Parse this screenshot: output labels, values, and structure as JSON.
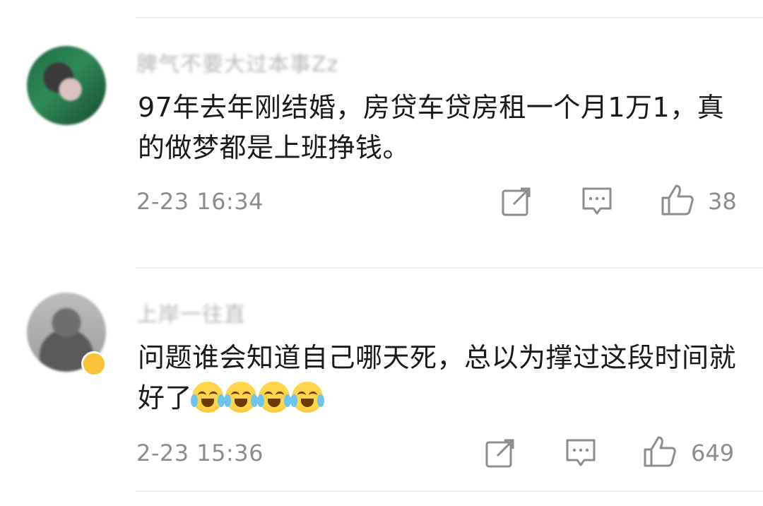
{
  "comments": [
    {
      "username": "脾气不要大过本事Zz",
      "text": "97年去年刚结婚，房贷车贷房租一个月1万1，真的做梦都是上班挣钱。",
      "time": "2-23 16:34",
      "likes": "38",
      "has_vip_badge": false,
      "icons": [
        "share-icon",
        "reply-icon",
        "like-icon"
      ]
    },
    {
      "username": "上岸一往直",
      "text": "问题谁会知道自己哪天死，总以为撑过这段时间就好了",
      "emojis": [
        "crying-laughing-emoji",
        "crying-laughing-emoji",
        "crying-laughing-emoji",
        "crying-laughing-emoji"
      ],
      "time": "2-23 15:36",
      "likes": "649",
      "has_vip_badge": true,
      "icons": [
        "share-icon",
        "reply-icon",
        "like-icon"
      ]
    }
  ],
  "colors": {
    "text": "#1a1a1a",
    "meta": "#8d8d8d",
    "divider": "#ececec",
    "badge": "#f7c235"
  }
}
